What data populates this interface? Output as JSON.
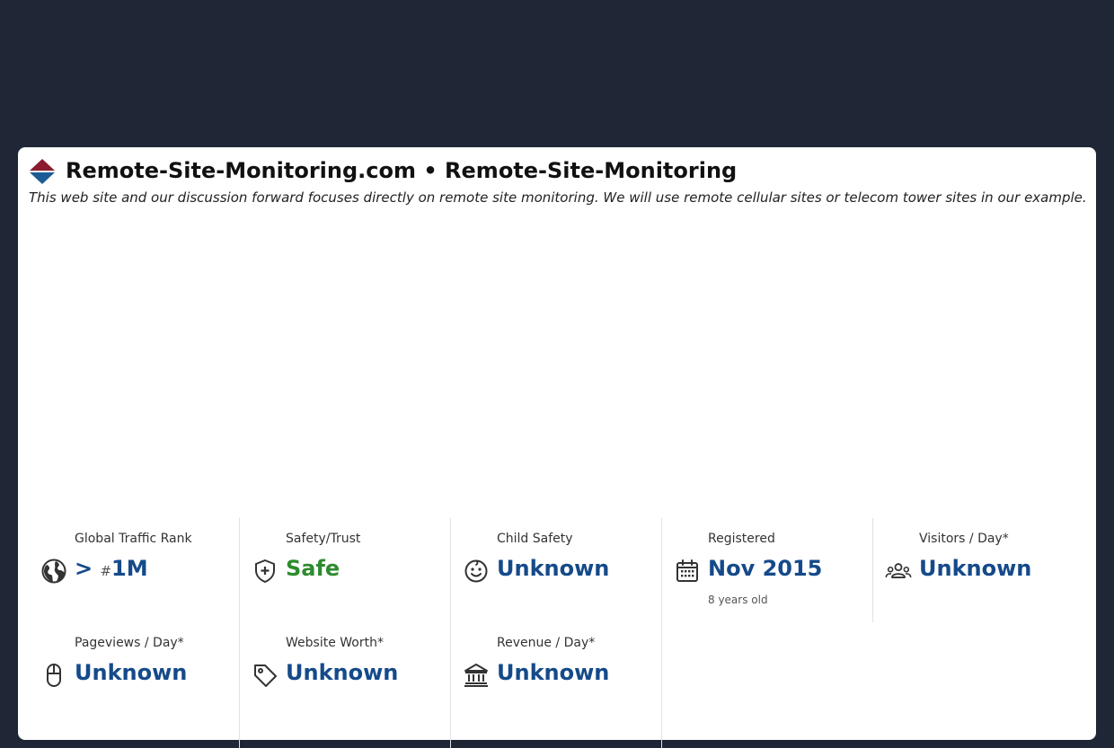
{
  "site": {
    "title": "Remote-Site-Monitoring.com • Remote-Site-Monitoring",
    "description": "This web site and our discussion forward focuses directly on remote site monitoring. We will use remote cellular sites or telecom tower sites in our example."
  },
  "colors": {
    "page_bg": "#1f2737",
    "value_blue": "#154a8a",
    "safe_green": "#2e8b2e",
    "logo_red": "#8a1c2e",
    "logo_blue": "#1c5c94"
  },
  "stats": {
    "traffic_rank": {
      "label": "Global Traffic Rank",
      "prefix": ">",
      "hash": "#",
      "value": "1M",
      "icon": "globe-icon"
    },
    "safety": {
      "label": "Safety/Trust",
      "value": "Safe",
      "icon": "shield-plus-icon"
    },
    "child_safety": {
      "label": "Child Safety",
      "value": "Unknown",
      "icon": "baby-face-icon"
    },
    "registered": {
      "label": "Registered",
      "value": "Nov 2015",
      "sub": "8 years old",
      "icon": "calendar-icon"
    },
    "visitors": {
      "label": "Visitors / Day*",
      "value": "Unknown",
      "icon": "people-icon"
    },
    "pageviews": {
      "label": "Pageviews / Day*",
      "value": "Unknown",
      "icon": "mouse-icon"
    },
    "worth": {
      "label": "Website Worth*",
      "value": "Unknown",
      "icon": "price-tag-icon"
    },
    "revenue": {
      "label": "Revenue / Day*",
      "value": "Unknown",
      "icon": "bank-icon"
    }
  }
}
